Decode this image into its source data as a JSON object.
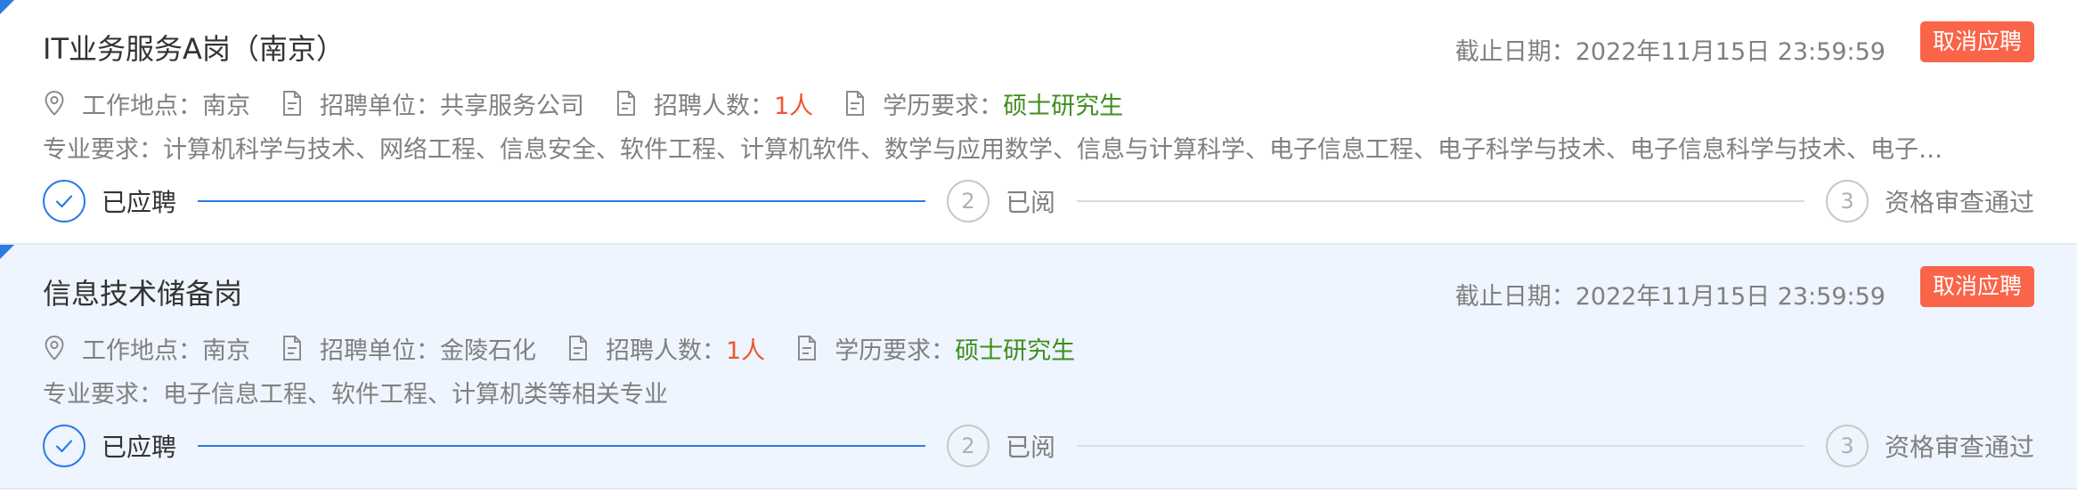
{
  "colors": {
    "accent": "#2c7be5",
    "button": "#fa6449",
    "count": "#f0562e",
    "degree": "#3f8d1f",
    "alt_card_bg": "#eef5fe"
  },
  "jobs": [
    {
      "title": "IT业务服务A岗（南京）",
      "deadline_label": "截止日期：",
      "deadline_value": "2022年11月15日 23:59:59",
      "cancel_label": "取消应聘",
      "location_label": "工作地点：",
      "location_value": "南京",
      "unit_label": "招聘单位：",
      "unit_value": "共享服务公司",
      "count_label": "招聘人数：",
      "count_value": "1人",
      "degree_label": "学历要求：",
      "degree_value": "硕士研究生",
      "major": "专业要求：计算机科学与技术、网络工程、信息安全、软件工程、计算机软件、数学与应用数学、信息与计算科学、电子信息工程、电子科学与技术、电子信息科学与技术、电子…",
      "steps": [
        {
          "num": "",
          "label": "已应聘",
          "state": "done"
        },
        {
          "num": "2",
          "label": "已阅",
          "state": "todo"
        },
        {
          "num": "3",
          "label": "资格审查通过",
          "state": "todo"
        }
      ]
    },
    {
      "title": "信息技术储备岗",
      "deadline_label": "截止日期：",
      "deadline_value": "2022年11月15日 23:59:59",
      "cancel_label": "取消应聘",
      "location_label": "工作地点：",
      "location_value": "南京",
      "unit_label": "招聘单位：",
      "unit_value": "金陵石化",
      "count_label": "招聘人数：",
      "count_value": "1人",
      "degree_label": "学历要求：",
      "degree_value": "硕士研究生",
      "major": "专业要求：电子信息工程、软件工程、计算机类等相关专业",
      "steps": [
        {
          "num": "",
          "label": "已应聘",
          "state": "done"
        },
        {
          "num": "2",
          "label": "已阅",
          "state": "todo"
        },
        {
          "num": "3",
          "label": "资格审查通过",
          "state": "todo"
        }
      ]
    }
  ]
}
